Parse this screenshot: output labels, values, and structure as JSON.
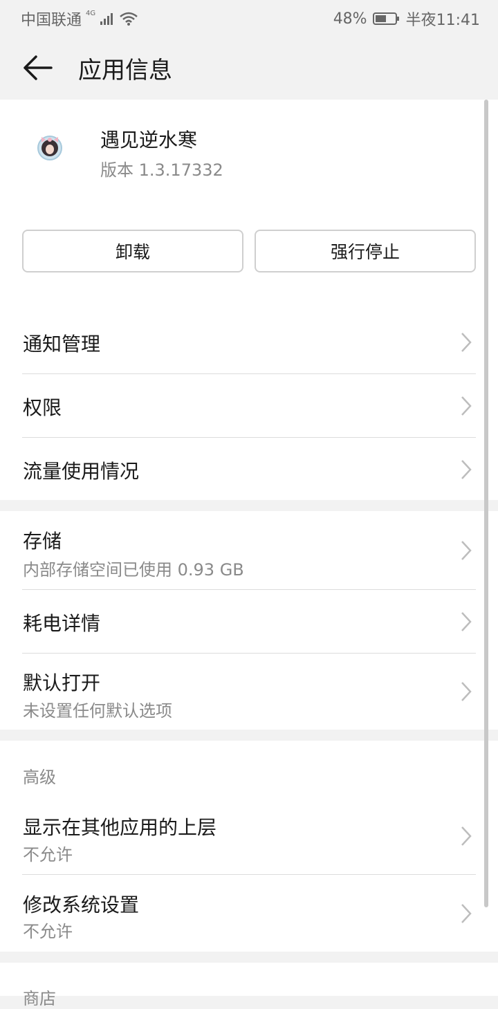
{
  "status_bar": {
    "carrier": "中国联通",
    "network": "4G",
    "battery": "48%",
    "time": "半夜11:41",
    "icons": [
      "signal-icon",
      "wifi-icon",
      "battery-icon"
    ]
  },
  "app_bar": {
    "title": "应用信息",
    "back_icon": "arrow-left-icon"
  },
  "app": {
    "name": "遇见逆水寒",
    "version": "版本 1.3.17332"
  },
  "actions": {
    "uninstall": "卸载",
    "force_stop": "强行停止"
  },
  "group1": [
    {
      "title": "通知管理"
    },
    {
      "title": "权限"
    },
    {
      "title": "流量使用情况"
    }
  ],
  "group2": [
    {
      "title": "存储",
      "subtitle": "内部存储空间已使用 0.93 GB"
    },
    {
      "title": "耗电详情"
    },
    {
      "title": "默认打开",
      "subtitle": "未设置任何默认选项"
    }
  ],
  "advanced": {
    "label": "高级",
    "items": [
      {
        "title": "显示在其他应用的上层",
        "subtitle": "不允许"
      },
      {
        "title": "修改系统设置",
        "subtitle": "不允许"
      }
    ]
  },
  "store": {
    "label": "商店"
  },
  "colors": {
    "background": "#f2f2f2",
    "card": "#ffffff",
    "secondary_text": "#8a8a8a"
  }
}
